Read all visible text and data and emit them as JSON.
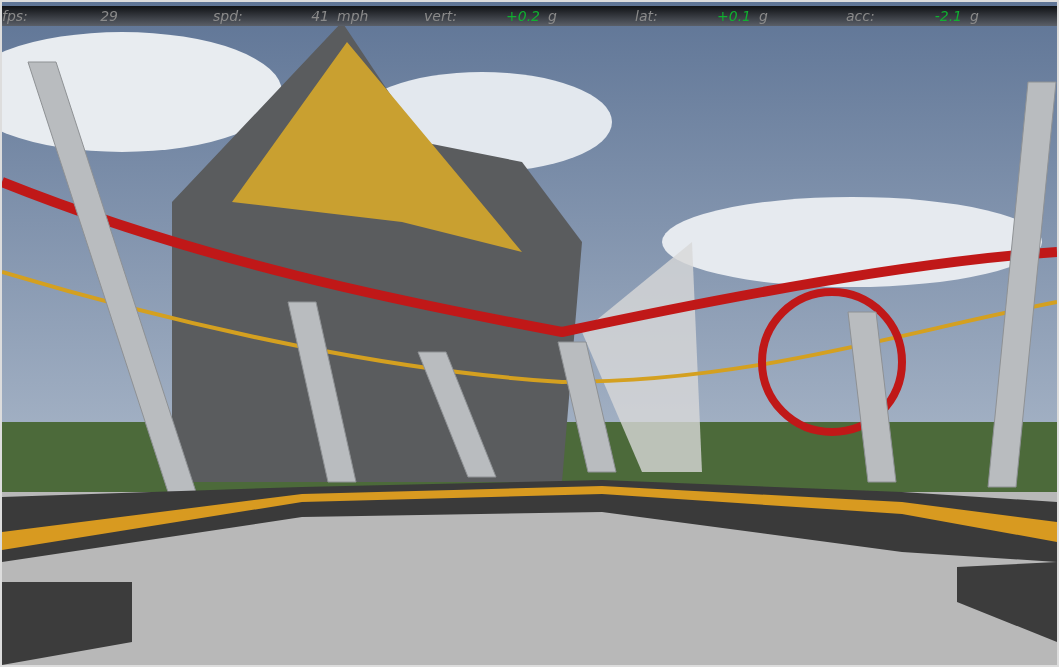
{
  "hud": [
    {
      "label": "fps:",
      "value": "29",
      "color": "#8a8a8a"
    },
    {
      "label": "spd:",
      "value": "41",
      "unit": "mph",
      "color": "#8a8a8a"
    },
    {
      "label": "vert:",
      "value": "+0.2",
      "unit": "g",
      "color": "#10b030"
    },
    {
      "label": "lat:",
      "value": "+0.1",
      "unit": "g",
      "color": "#10b030"
    },
    {
      "label": "acc:",
      "value": "-2.1",
      "unit": "g",
      "color": "#10b030"
    }
  ]
}
